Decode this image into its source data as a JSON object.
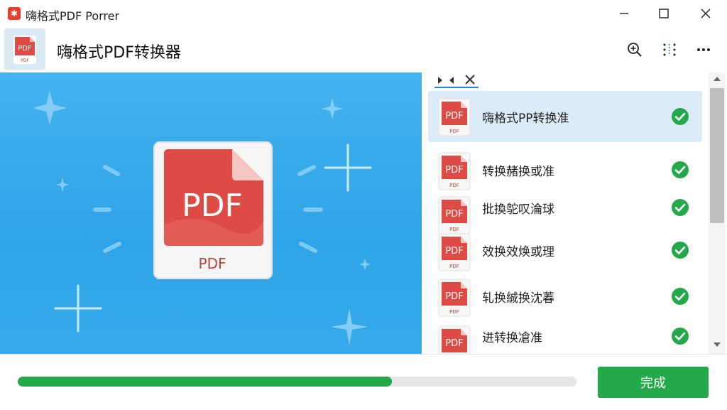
{
  "window": {
    "title": "嗨格式PDF Porrer",
    "controls": [
      "minimize-icon",
      "maximize-icon",
      "close-icon"
    ]
  },
  "header": {
    "title": "嗨格式PDF转换器",
    "tools": [
      "zoom-icon",
      "grid-sort-icon",
      "more-icon"
    ]
  },
  "hero": {
    "document_label": "PDF",
    "document_caption": "PDF"
  },
  "panel": {
    "tab_icons": [
      "arrow-right-icon",
      "arrow-left-icon",
      "close-icon"
    ]
  },
  "file_list": [
    {
      "label": "嗨格式PP转换准",
      "thumb_label": "PDF",
      "thumb_caption": "PDF",
      "status": "done"
    },
    {
      "label": "转换赭换或准",
      "thumb_label": "PDF",
      "thumb_caption": "PDF",
      "status": "done"
    },
    {
      "label": "批換鸵叹淪球",
      "thumb_label": "PDF",
      "thumb_caption": "PDF",
      "status": "done"
    },
    {
      "label": "效换效焕或理",
      "thumb_label": "PDF",
      "thumb_caption": "PDF",
      "status": "done"
    },
    {
      "label": "轧换絾换沈萶",
      "thumb_label": "PDF",
      "thumb_caption": "PDF",
      "status": "done"
    },
    {
      "label": "进转换凔准",
      "thumb_label": "PDF",
      "thumb_caption": "PDF",
      "status": "done"
    }
  ],
  "footer": {
    "progress_percent": 67,
    "done_label": "完成"
  },
  "colors": {
    "accent_green": "#23a84a",
    "pdf_red": "#de4a44",
    "hero_blue": "#34a9ea",
    "selected_row": "#dcebf8"
  }
}
